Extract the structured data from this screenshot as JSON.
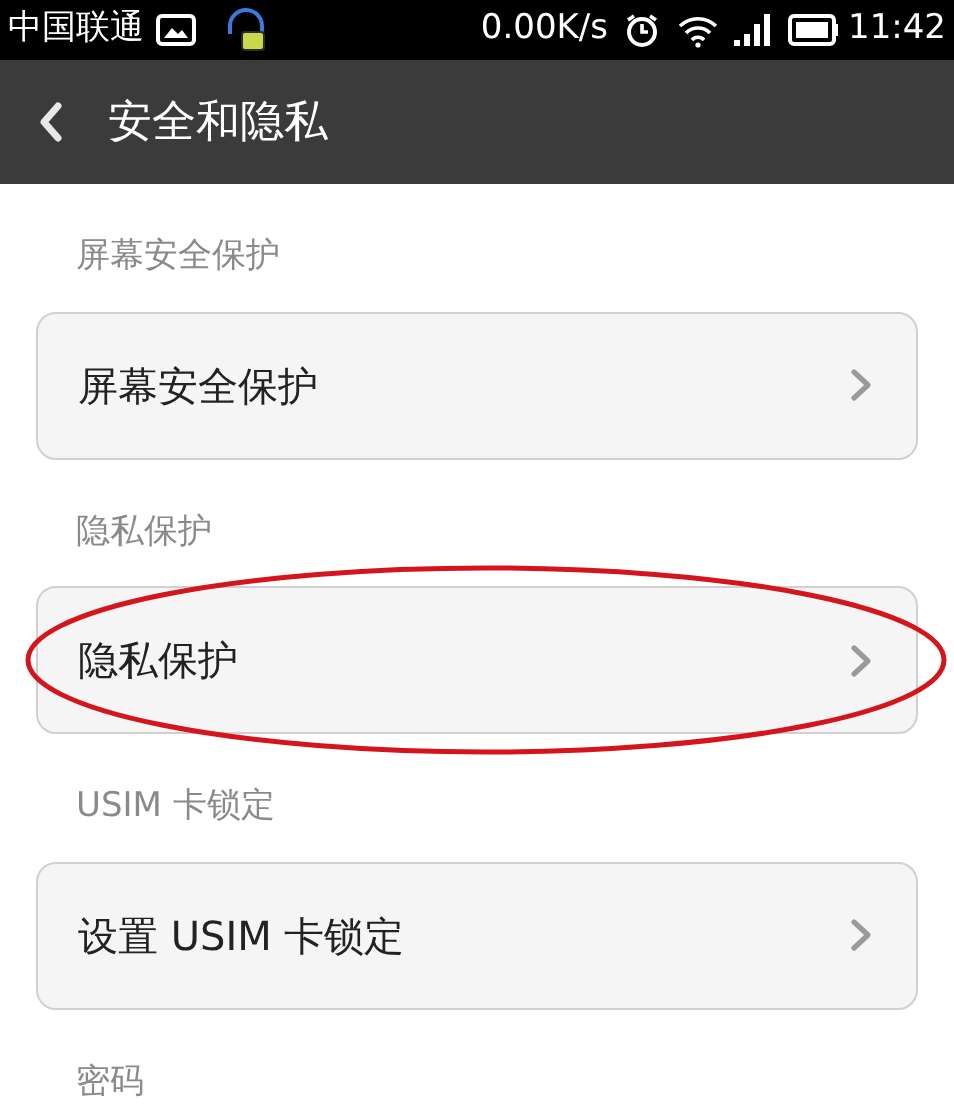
{
  "status_bar": {
    "carrier": "中国联通",
    "speed": "0.00K/s",
    "time": "11:42"
  },
  "title_bar": {
    "title": "安全和隐私"
  },
  "sections": [
    {
      "header": "屏幕安全保护",
      "item": {
        "label": "屏幕安全保护",
        "circled": false
      }
    },
    {
      "header": "隐私保护",
      "item": {
        "label": "隐私保护",
        "circled": true
      }
    },
    {
      "header": "USIM 卡锁定",
      "item": {
        "label": "设置 USIM 卡锁定",
        "circled": false
      }
    },
    {
      "header": "密码"
    }
  ]
}
